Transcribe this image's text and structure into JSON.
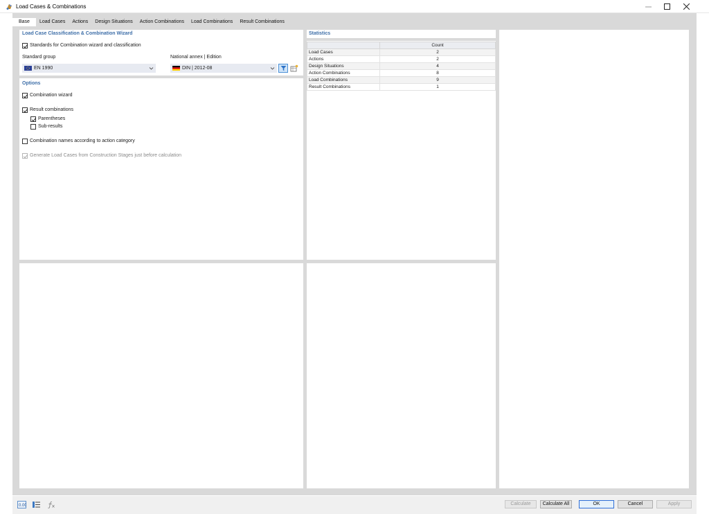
{
  "window": {
    "title": "Load Cases & Combinations"
  },
  "tabs": [
    {
      "label": "Base",
      "active": true
    },
    {
      "label": "Load Cases"
    },
    {
      "label": "Actions"
    },
    {
      "label": "Design Situations"
    },
    {
      "label": "Action Combinations"
    },
    {
      "label": "Load Combinations"
    },
    {
      "label": "Result Combinations"
    }
  ],
  "wizard": {
    "section_title": "Load Case Classification & Combination Wizard",
    "standards_checkbox": {
      "label": "Standards for Combination wizard and classification",
      "checked": true
    },
    "standard_group": {
      "label": "Standard group",
      "value": "EN 1990"
    },
    "national_annex": {
      "label": "National annex | Edition",
      "value": "DIN | 2012-08"
    }
  },
  "options": {
    "section_title": "Options",
    "combination_wizard": {
      "label": "Combination wizard",
      "checked": true
    },
    "result_combinations": {
      "label": "Result combinations",
      "checked": true
    },
    "parentheses": {
      "label": "Parentheses",
      "checked": true
    },
    "sub_results": {
      "label": "Sub-results",
      "checked": false
    },
    "combination_names": {
      "label": "Combination names according to action category",
      "checked": false
    },
    "generate_load_cases": {
      "label": "Generate Load Cases from Construction Stages just before calculation",
      "checked": true,
      "disabled": true
    }
  },
  "statistics": {
    "section_title": "Statistics",
    "column_header": "Count",
    "rows": [
      {
        "name": "Load Cases",
        "count": "2"
      },
      {
        "name": "Actions",
        "count": "2"
      },
      {
        "name": "Design Situations",
        "count": "4"
      },
      {
        "name": "Action Combinations",
        "count": "8"
      },
      {
        "name": "Load Combinations",
        "count": "9"
      },
      {
        "name": "Result Combinations",
        "count": "1"
      }
    ]
  },
  "footer": {
    "calculate": "Calculate",
    "calculate_all": "Calculate All",
    "ok": "OK",
    "cancel": "Cancel",
    "apply": "Apply",
    "icons": [
      "units-icon",
      "settings-table-icon",
      "formula-icon"
    ]
  },
  "colors": {
    "section_title": "#3d6ea8",
    "combo_bg": "#e7eaf1",
    "frame_bg": "#d9d9d9",
    "primary_border": "#2f6fd8"
  }
}
